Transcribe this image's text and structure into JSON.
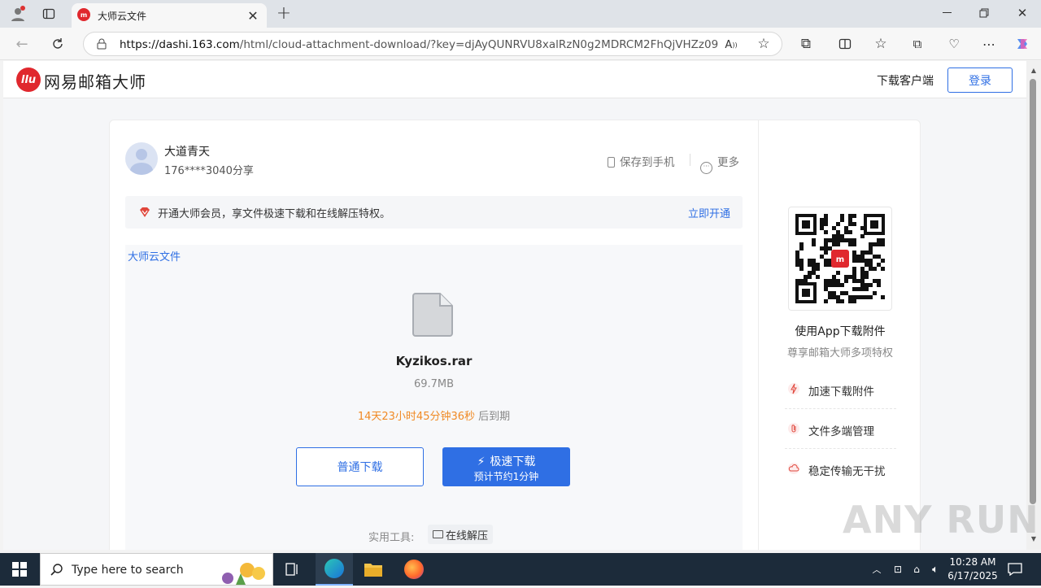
{
  "browser": {
    "tab_title": "大师云文件",
    "url_host": "https://dashi.163.com",
    "url_path": "/html/cloud-attachment-download/?key=djAyQUNRVU8xalRzN0g2MDRCM2FhQjVHZz09"
  },
  "header": {
    "logo_mark": "llu",
    "logo_text": "网易邮箱大师",
    "download_client": "下载客户端",
    "login": "登录"
  },
  "sharer": {
    "name": "大道青天",
    "phone": "176****3040分享",
    "save_to_phone": "保存到手机",
    "more": "更多"
  },
  "banner": {
    "text": "开通大师会员，享文件极速下载和在线解压特权。",
    "link": "立即开通"
  },
  "file": {
    "source": "大师云文件",
    "name": "Kyzikos.rar",
    "size": "69.7MB",
    "expire_time": "14天23小时45分钟36秒",
    "expire_suffix": " 后到期",
    "normal_download": "普通下载",
    "fast_download": "极速下载",
    "fast_download_sub": "预计节约1分钟",
    "tools_label": "实用工具:",
    "online_unzip": "在线解压"
  },
  "side": {
    "title": "使用App下载附件",
    "subtitle": "尊享邮箱大师多项特权",
    "features": [
      "加速下载附件",
      "文件多端管理",
      "稳定传输无干扰"
    ]
  },
  "watermark": "ANY RUN",
  "taskbar": {
    "search_placeholder": "Type here to search",
    "time": "10:28 AM",
    "date": "6/17/2025"
  },
  "colors": {
    "brand_red": "#e0282e",
    "link_blue": "#2f6fe4",
    "expire_orange": "#f08a24"
  }
}
